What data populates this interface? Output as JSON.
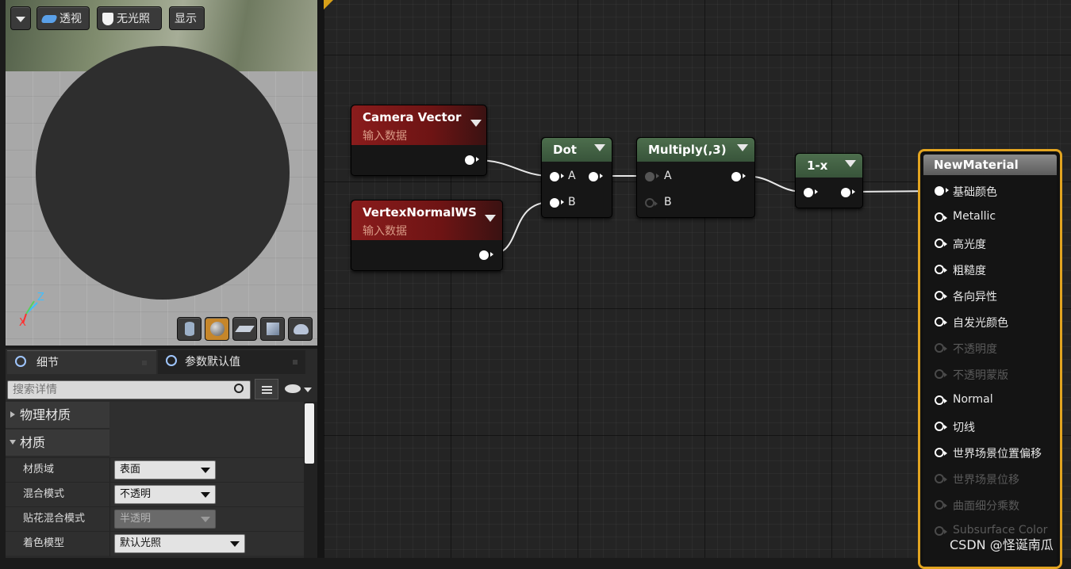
{
  "viewport": {
    "dropdown_icon": "chevron-down-icon",
    "perspective_label": "透视",
    "unlit_label": "无光照",
    "show_label": "显示",
    "axis_z": "Z",
    "axis_x": "X",
    "preview_shapes": [
      "cylinder-icon",
      "sphere-icon",
      "plane-icon",
      "cube-icon",
      "teapot-icon"
    ]
  },
  "details": {
    "tabs": [
      {
        "label": "细节"
      },
      {
        "label": "参数默认值"
      }
    ],
    "search_placeholder": "搜索详情",
    "categories": [
      {
        "label": "物理材质",
        "expanded": false
      },
      {
        "label": "材质",
        "expanded": true
      }
    ],
    "properties": [
      {
        "name": "材质域",
        "value": "表面"
      },
      {
        "name": "混合模式",
        "value": "不透明"
      },
      {
        "name": "贴花混合模式",
        "value": "半透明"
      },
      {
        "name": "着色模型",
        "value": "默认光照"
      }
    ]
  },
  "graph": {
    "nodes": {
      "camera_vector": {
        "title": "Camera Vector",
        "subtitle": "输入数据"
      },
      "vertex_normal": {
        "title": "VertexNormalWS",
        "subtitle": "输入数据"
      },
      "dot": {
        "title": "Dot",
        "pin_a": "A",
        "pin_b": "B"
      },
      "multiply": {
        "title": "Multiply(,3)",
        "pin_a": "A",
        "pin_b": "B"
      },
      "one_minus": {
        "title": "1-x"
      }
    },
    "material": {
      "title": "NewMaterial",
      "pins": [
        {
          "label": "基础颜色",
          "state": "connected"
        },
        {
          "label": "Metallic",
          "state": "active"
        },
        {
          "label": "高光度",
          "state": "active"
        },
        {
          "label": "粗糙度",
          "state": "active"
        },
        {
          "label": "各向异性",
          "state": "active"
        },
        {
          "label": "自发光颜色",
          "state": "active"
        },
        {
          "label": "不透明度",
          "state": "disabled"
        },
        {
          "label": "不透明蒙版",
          "state": "disabled"
        },
        {
          "label": "Normal",
          "state": "active"
        },
        {
          "label": "切线",
          "state": "active"
        },
        {
          "label": "世界场景位置偏移",
          "state": "active"
        },
        {
          "label": "世界场景位移",
          "state": "disabled"
        },
        {
          "label": "曲面细分乘数",
          "state": "disabled"
        },
        {
          "label": "Subsurface Color",
          "state": "disabled"
        }
      ]
    }
  },
  "watermark": "CSDN @怪诞南瓜",
  "colors": {
    "accent": "#e2a420",
    "input_node": "#8a1c1c",
    "function_node": "#4d6e4d"
  }
}
